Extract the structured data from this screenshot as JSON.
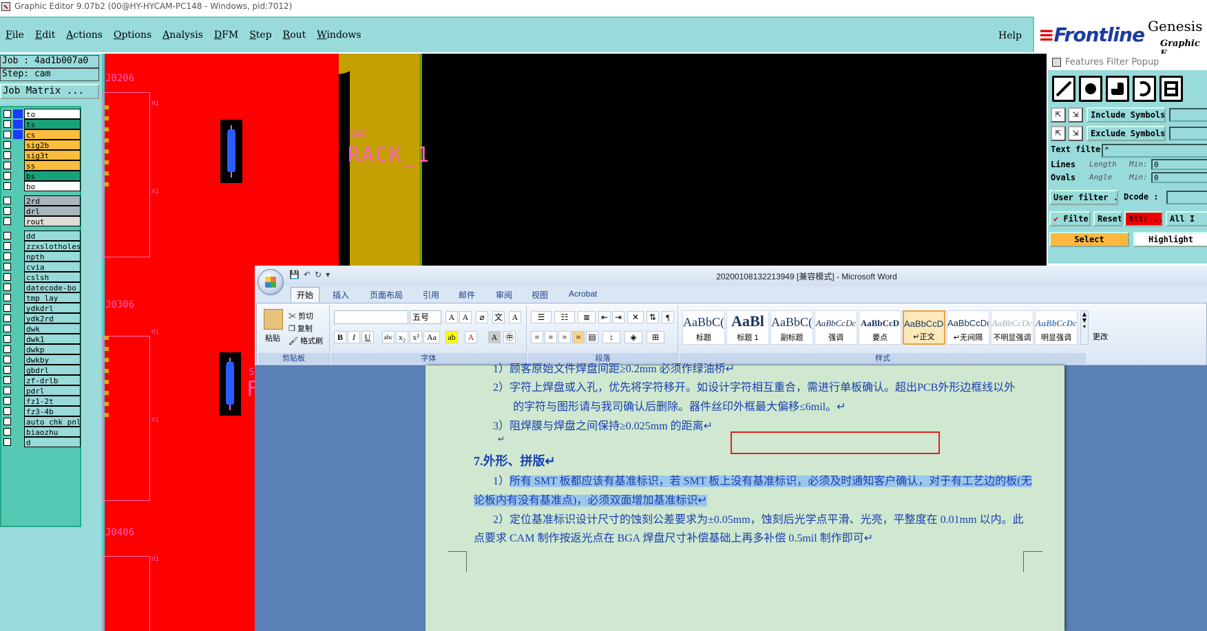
{
  "titlebar": {
    "title": "Graphic Editor 9.07b2 (00@HY-HYCAM-PC148 - Windows, pid:7012)"
  },
  "menu": {
    "items": [
      "File",
      "Edit",
      "Actions",
      "Options",
      "Analysis",
      "DFM",
      "Step",
      "Rout",
      "Windows"
    ],
    "help": "Help"
  },
  "brand": {
    "logo": "Frontline",
    "product": "Genesis",
    "subtitle": "Graphic E"
  },
  "left": {
    "job": "Job : 4ad1b007a0",
    "step": "Step: cam",
    "job_matrix": "Job Matrix ...",
    "layers": [
      {
        "name": "to",
        "color": "#1a3cff",
        "bg": "#ffffff"
      },
      {
        "name": "ts",
        "color": "#1a3cff",
        "bg": "#19a27a"
      },
      {
        "name": "cs",
        "color": "#1a3cff",
        "bg": "#fbbd3d"
      },
      {
        "name": "sig2b",
        "color": "",
        "bg": "#fbbd3d"
      },
      {
        "name": "sig3t",
        "color": "",
        "bg": "#fbbd3d"
      },
      {
        "name": "ss",
        "color": "",
        "bg": "#fbbd3d"
      },
      {
        "name": "bs",
        "color": "",
        "bg": "#19a27a"
      },
      {
        "name": "bo",
        "color": "",
        "bg": "#ffffff"
      },
      {
        "name": "2rd",
        "color": "",
        "bg": "#a9b6bd"
      },
      {
        "name": "drl",
        "color": "",
        "bg": "#a9b6bd"
      },
      {
        "name": "rout",
        "color": "",
        "bg": "#e0dcd6"
      },
      {
        "name": "dd",
        "color": "",
        "bg": "#99dada"
      },
      {
        "name": "zzxslotholes",
        "color": "",
        "bg": "#99dada"
      },
      {
        "name": "npth",
        "color": "",
        "bg": "#99dada"
      },
      {
        "name": "cvia",
        "color": "",
        "bg": "#99dada"
      },
      {
        "name": "cslsh",
        "color": "",
        "bg": "#99dada"
      },
      {
        "name": "datecode-bo",
        "color": "",
        "bg": "#99dada"
      },
      {
        "name": "tmp_lay",
        "color": "",
        "bg": "#99dada"
      },
      {
        "name": "ydkdrl",
        "color": "",
        "bg": "#99dada"
      },
      {
        "name": "ydk2rd",
        "color": "",
        "bg": "#99dada"
      },
      {
        "name": "dwk",
        "color": "",
        "bg": "#99dada"
      },
      {
        "name": "dwk1",
        "color": "",
        "bg": "#99dada"
      },
      {
        "name": "dwkp",
        "color": "",
        "bg": "#99dada"
      },
      {
        "name": "dwkby",
        "color": "",
        "bg": "#99dada"
      },
      {
        "name": "gbdrl",
        "color": "",
        "bg": "#99dada"
      },
      {
        "name": "zf-drlb",
        "color": "",
        "bg": "#99dada"
      },
      {
        "name": "pdrl",
        "color": "",
        "bg": "#99dada"
      },
      {
        "name": "fz1-2t",
        "color": "",
        "bg": "#99dada"
      },
      {
        "name": "fz3-4b",
        "color": "",
        "bg": "#99dada"
      },
      {
        "name": "auto_chk_pnl",
        "color": "",
        "bg": "#99dada"
      },
      {
        "name": "biaozhu",
        "color": "",
        "bg": "#99dada"
      },
      {
        "name": "d",
        "color": "",
        "bg": "#99dada"
      }
    ]
  },
  "canvas": {
    "labels": [
      "J0206",
      "J0306",
      "J0406"
    ],
    "small": [
      "H1",
      "A1",
      "H1",
      "A1",
      "H1"
    ],
    "sw2": "SW2",
    "rack": "RACK_1",
    "partial": [
      "S",
      "F"
    ]
  },
  "ffp": {
    "title": "Features Filter Popup",
    "include": "Include Symbols :",
    "exclude": "Exclude Symbols :",
    "text_filter": "Text filter",
    "text_filter_value": "*",
    "lines": "Lines",
    "ovals": "Ovals",
    "length": "Length",
    "angle": "Angle",
    "min": "Min:",
    "min_val1": "0",
    "min_val2": "0",
    "user_filter": "User filter ...",
    "dcode": "Dcode :",
    "filter": "Filter",
    "reset": "Reset",
    "attr": "Attr ...",
    "all": "All I",
    "select": "Select",
    "highlight": "Highlight"
  },
  "word": {
    "title": "20200108132213949 [兼容模式] - Microsoft Word",
    "tabs": [
      "开始",
      "插入",
      "页面布局",
      "引用",
      "邮件",
      "审阅",
      "视图",
      "Acrobat"
    ],
    "clipboard": {
      "paste": "粘贴",
      "cut": "剪切",
      "copy": "复制",
      "painter": "格式刷",
      "label": "剪贴板"
    },
    "font": {
      "size": "五号",
      "label": "字体"
    },
    "paragraph": {
      "label": "段落"
    },
    "styles": {
      "label": "样式",
      "items": [
        {
          "sample": "AaBbC(",
          "name": "标题"
        },
        {
          "sample": "AaBl",
          "name": "标题 1"
        },
        {
          "sample": "AaBbC(",
          "name": "副标题"
        },
        {
          "sample": "AaBbCcDc",
          "name": "强调"
        },
        {
          "sample": "AaBbCcD",
          "name": "要点"
        },
        {
          "sample": "AaBbCcDc",
          "name": "↵正文"
        },
        {
          "sample": "AaBbCcDc",
          "name": "↵无间隔"
        },
        {
          "sample": "AaBbCcDc",
          "name": "不明显强调"
        },
        {
          "sample": "AaBbCcDc",
          "name": "明显强调"
        }
      ],
      "more": "更改"
    },
    "doc": {
      "line0": "1）顾客原始文件焊盘间距≥0.2mm 必须作绿油桥↵",
      "line1": "2）字符上焊盘或入孔，优先将字符移开。如设计字符相互重合，需进行单板确认。超出PCB外形边框线以外",
      "line2": "的字符与图形请与我司确认后删除。器件丝印外框最大偏移≤6mil。↵",
      "line3": "3）阻焊膜与焊盘之间保持≥0.025mm 的距离↵",
      "line4": "↵",
      "heading": "7.外形、拼版↵",
      "p1a": "1）",
      "p1b": "所有 SMT 板都应该有基准标识，若 SMT 板上没有基准标识，必须及时通知客户确认，对于有工艺边的板(无",
      "p1c": "论板内有没有基准点)，必须双面增加基准标识↵",
      "p2a": "2）定位基准标识设计尺寸的蚀刻公差要求为±0.05mm，蚀刻后光学点平滑、光亮，平整度在 0.01mm 以内。此",
      "p2b": "点要求 CAM 制作按返光点在 BGA 焊盘尺寸补偿基础上再多补偿 0.5mil 制作即可↵"
    }
  }
}
